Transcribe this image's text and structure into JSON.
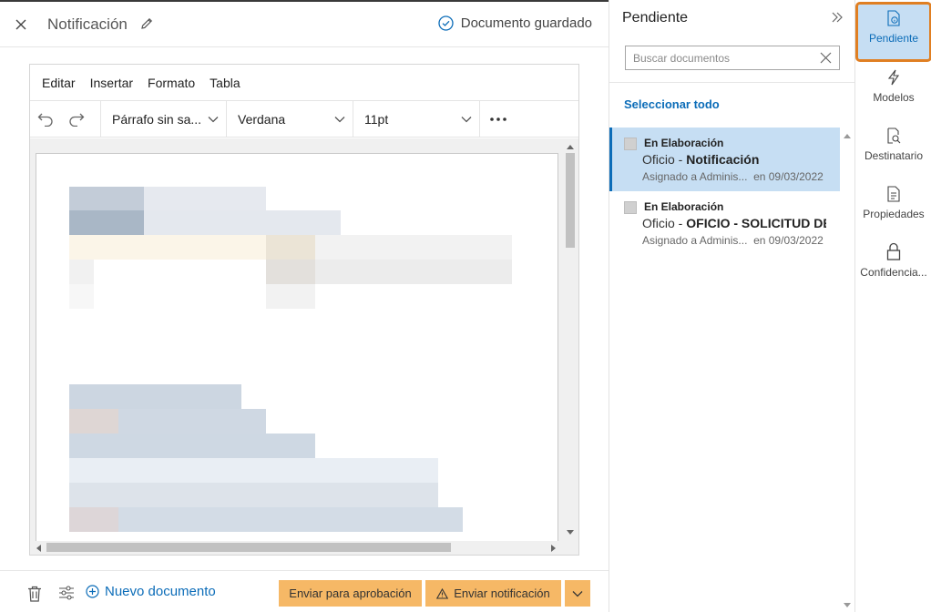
{
  "header": {
    "title": "Notificación",
    "saved_status": "Documento guardado"
  },
  "editor": {
    "menu": [
      "Editar",
      "Insertar",
      "Formato",
      "Tabla"
    ],
    "paragraph_style": "Párrafo sin sa...",
    "font_family": "Verdana",
    "font_size": "11pt"
  },
  "footer": {
    "new_document": "Nuevo documento",
    "send_approval": "Enviar para aprobación",
    "send_notification": "Enviar notificación"
  },
  "pending": {
    "title": "Pendiente",
    "search_placeholder": "Buscar documentos",
    "select_all": "Seleccionar todo",
    "items": [
      {
        "status": "En Elaboración",
        "type": "Oficio",
        "separator": " - ",
        "name": "Notificación",
        "assigned": "Asignado a Adminis...",
        "date": "en 09/03/2022",
        "selected": true
      },
      {
        "status": "En Elaboración",
        "type": "Oficio",
        "separator": " - ",
        "name": "OFICIO - SOLICITUD DE",
        "assigned": "Asignado a Adminis...",
        "date": "en 09/03/2022",
        "selected": false
      }
    ]
  },
  "rail": {
    "items": [
      "Pendiente",
      "Modelos",
      "Destinatario",
      "Propiedades",
      "Confidencia..."
    ]
  },
  "colors": {
    "accent": "#0b6cb8",
    "selected_bg": "#c6def3",
    "action_button": "#f6b866",
    "highlight_border": "#e07f22"
  },
  "icons": [
    "close-icon",
    "pencil-icon",
    "check-circle-icon",
    "undo-icon",
    "redo-icon",
    "chevron-down-icon",
    "more-icon",
    "trash-icon",
    "sliders-icon",
    "plus-circle-icon",
    "warning-icon",
    "double-chevron-right-icon",
    "clear-icon",
    "document-info-icon",
    "lightning-icon",
    "document-search-icon",
    "document-list-icon",
    "lock-icon"
  ]
}
